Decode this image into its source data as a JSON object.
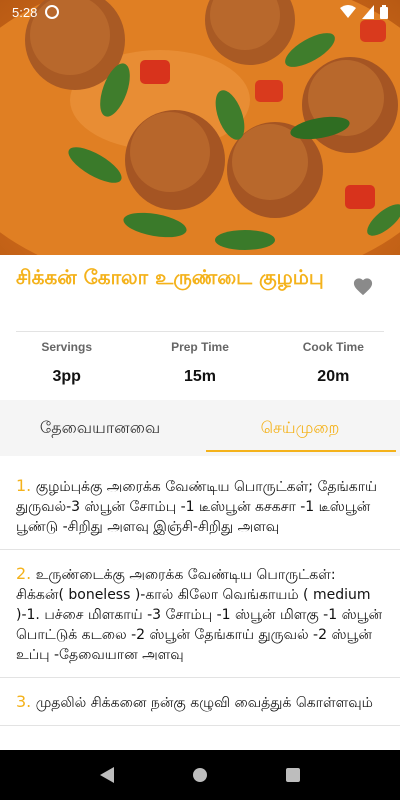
{
  "status": {
    "time": "5:28"
  },
  "recipe": {
    "title": "சிக்கன் கோலா உருண்டை குழம்பு",
    "stats": [
      {
        "label": "Servings",
        "value": "3pp"
      },
      {
        "label": "Prep Time",
        "value": "15m"
      },
      {
        "label": "Cook Time",
        "value": "20m"
      }
    ]
  },
  "tabs": [
    {
      "label": "தேவையானவை",
      "active": false
    },
    {
      "label": "செய்முறை",
      "active": true
    }
  ],
  "steps": [
    {
      "num": "1.",
      "text": "குழம்புக்கு அரைக்க வேண்டிய பொருட்கள்; தேங்காய் துருவல்-3 ஸ்பூன் சோம்பு -1 டீஸ்பூன் கசகசா -1 டீஸ்பூன் பூண்டு -சிறிது அளவு இஞ்சி-சிறிது அளவு"
    },
    {
      "num": "2.",
      "text": "உருண்டைக்கு அரைக்க வேண்டிய பொருட்கள்: சிக்கன்( boneless )-கால் கிலோ வெங்காயம் ( medium )-1. பச்சை மிளகாய் -3 சோம்பு -1 ஸ்பூன் மிளகு -1 ஸ்பூன் பொட்டுக் கடலை -2 ஸ்பூன் தேங்காய் துருவல் -2 ஸ்பூன் உப்பு -தேவையான அளவு"
    },
    {
      "num": "3.",
      "text": "முதலில் சிக்கனை நன்கு கழுவி வைத்துக் கொள்ளவும்"
    }
  ],
  "icons": {
    "favorite": "heart-icon",
    "back": "back-icon",
    "home": "home-icon",
    "recent": "recent-apps-icon"
  },
  "colors": {
    "accent": "#f4b21b",
    "favorite": "#8a8a8a"
  }
}
